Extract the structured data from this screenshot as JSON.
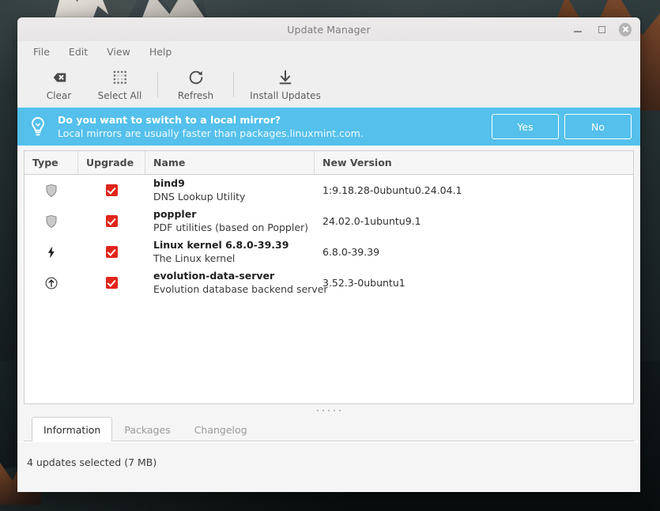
{
  "window": {
    "title": "Update Manager",
    "controls": {
      "minimize": "minimize-button",
      "maximize": "maximize-button",
      "close": "close-button"
    }
  },
  "menubar": {
    "items": [
      {
        "label": "File"
      },
      {
        "label": "Edit"
      },
      {
        "label": "View"
      },
      {
        "label": "Help"
      }
    ]
  },
  "toolbar": {
    "buttons": [
      {
        "label": "Clear",
        "icon": "clear-icon"
      },
      {
        "label": "Select All",
        "icon": "select-all-icon"
      },
      {
        "label": "Refresh",
        "icon": "refresh-icon"
      },
      {
        "label": "Install Updates",
        "icon": "install-updates-icon"
      }
    ]
  },
  "banner": {
    "icon": "lightbulb-icon",
    "title": "Do you want to switch to a local mirror?",
    "subtitle": "Local mirrors are usually faster than packages.linuxmint.com.",
    "yes_label": "Yes",
    "no_label": "No",
    "background_color": "#54c0eb"
  },
  "table": {
    "columns": [
      {
        "key": "type",
        "label": "Type"
      },
      {
        "key": "upgrade",
        "label": "Upgrade"
      },
      {
        "key": "name",
        "label": "Name"
      },
      {
        "key": "version",
        "label": "New Version"
      }
    ],
    "rows": [
      {
        "type_icon": "shield-icon",
        "checked": true,
        "name": "bind9",
        "description": "DNS Lookup Utility",
        "new_version": "1:9.18.28-0ubuntu0.24.04.1"
      },
      {
        "type_icon": "shield-icon",
        "checked": true,
        "name": "poppler",
        "description": "PDF utilities (based on Poppler)",
        "new_version": "24.02.0-1ubuntu9.1"
      },
      {
        "type_icon": "lightning-bolt-icon",
        "checked": true,
        "name": "Linux kernel 6.8.0-39.39",
        "description": "The Linux kernel",
        "new_version": "6.8.0-39.39"
      },
      {
        "type_icon": "circle-up-arrow-icon",
        "checked": true,
        "name": "evolution-data-server",
        "description": "Evolution database backend server",
        "new_version": "3.52.3-0ubuntu1"
      }
    ]
  },
  "tabs": [
    {
      "label": "Information",
      "active": true
    },
    {
      "label": "Packages",
      "active": false
    },
    {
      "label": "Changelog",
      "active": false
    }
  ],
  "status": {
    "text": "4 updates selected (7 MB)"
  },
  "colors": {
    "accent": "#54c0eb",
    "checkbox": "#e1251b",
    "window_bg": "#f5f5f5"
  }
}
